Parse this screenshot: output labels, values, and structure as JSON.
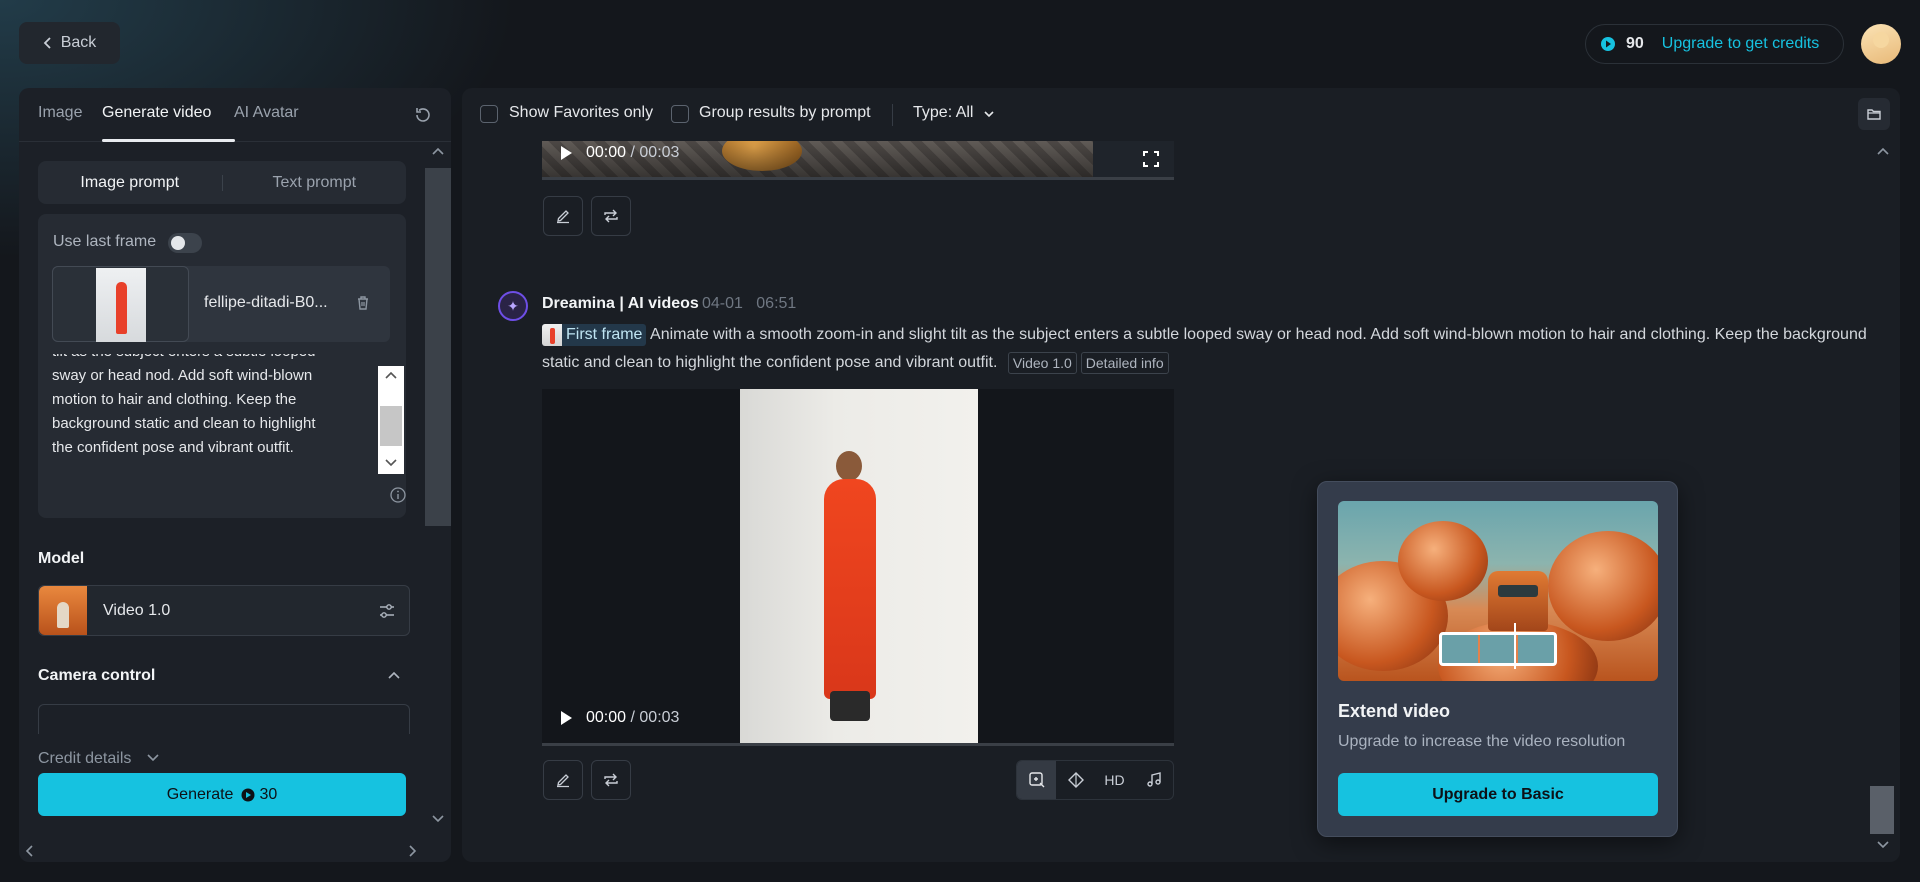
{
  "header": {
    "back_label": "Back",
    "credits": "90",
    "upgrade_label": "Upgrade to get credits"
  },
  "left": {
    "tabs": [
      {
        "label": "Image",
        "active": false
      },
      {
        "label": "Generate video",
        "active": true
      },
      {
        "label": "AI Avatar",
        "active": false
      }
    ],
    "prompt_modes": [
      {
        "label": "Image prompt",
        "active": true
      },
      {
        "label": "Text prompt",
        "active": false
      }
    ],
    "use_last_frame_label": "Use last frame",
    "use_last_frame_on": false,
    "file_name": "fellipe-ditadi-B0...",
    "prompt_lines": [
      "tilt as the subject enters a subtle looped",
      "sway or head nod. Add soft wind-blown",
      "motion to hair and clothing. Keep the",
      "background static and clean to highlight",
      "the confident pose and vibrant outfit."
    ],
    "model_label": "Model",
    "model_name": "Video 1.0",
    "camera_label": "Camera control",
    "credit_details_label": "Credit details",
    "generate_label": "Generate",
    "generate_cost": "30"
  },
  "right": {
    "filters": {
      "favorites_label": "Show Favorites only",
      "favorites_checked": false,
      "group_label": "Group results by prompt",
      "group_checked": false,
      "type_label": "Type: All"
    },
    "top_video": {
      "current": "00:00",
      "duration": "/ 00:03"
    },
    "entry": {
      "brand": "Dreamina | AI videos",
      "date": "04-01",
      "time": "06:51",
      "first_frame_label": "First frame",
      "prompt": "Animate with a smooth zoom-in and slight tilt as the subject enters a subtle looped sway or head nod. Add soft wind-blown motion to hair and clothing. Keep the background static and clean to highlight the confident pose and vibrant outfit.",
      "model_tag": "Video 1.0",
      "info_tag": "Detailed info",
      "video": {
        "current": "00:00",
        "duration": "/ 00:03"
      },
      "tools": [
        "extend-icon",
        "diamond-icon",
        "HD",
        "music-icon"
      ]
    },
    "popover": {
      "title": "Extend video",
      "subtitle": "Upgrade to increase the video resolution",
      "button_label": "Upgrade to Basic"
    }
  },
  "colors": {
    "accent": "#16c2e0",
    "background": "#14171c",
    "panel": "#1c2027"
  }
}
